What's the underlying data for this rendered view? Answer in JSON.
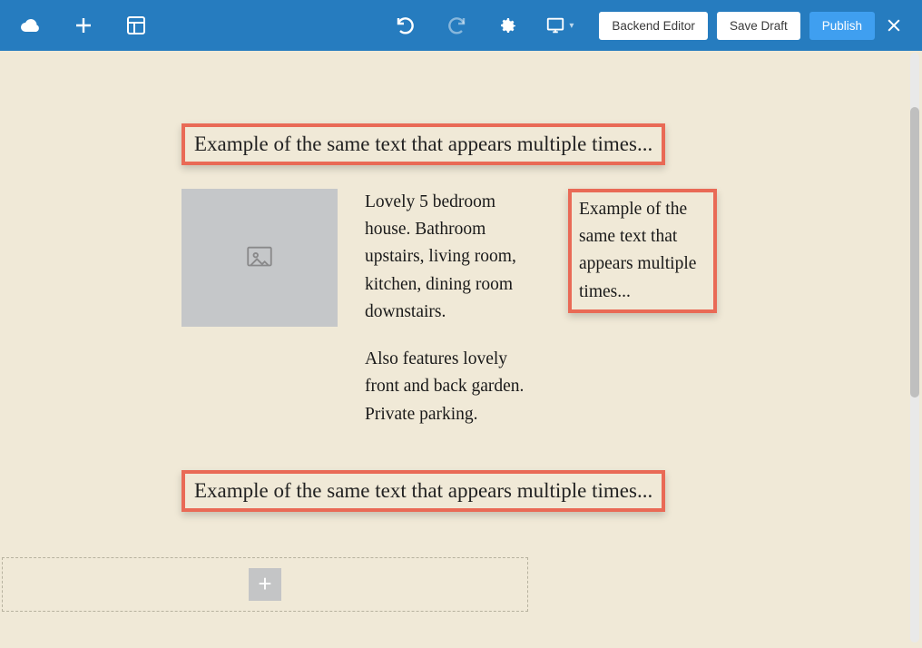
{
  "toolbar": {
    "backend_label": "Backend Editor",
    "save_label": "Save Draft",
    "publish_label": "Publish"
  },
  "content": {
    "heading1": "Example of the same text that appears multiple times...",
    "body_p1": "Lovely 5 bedroom house. Bathroom upstairs, living room, kitchen, dining room downstairs.",
    "body_p2": "Also features lovely front and back garden. Private parking.",
    "side_text": "Example of the same text that appears multiple times...",
    "heading2": "Example of the same text that appears multiple times..."
  }
}
